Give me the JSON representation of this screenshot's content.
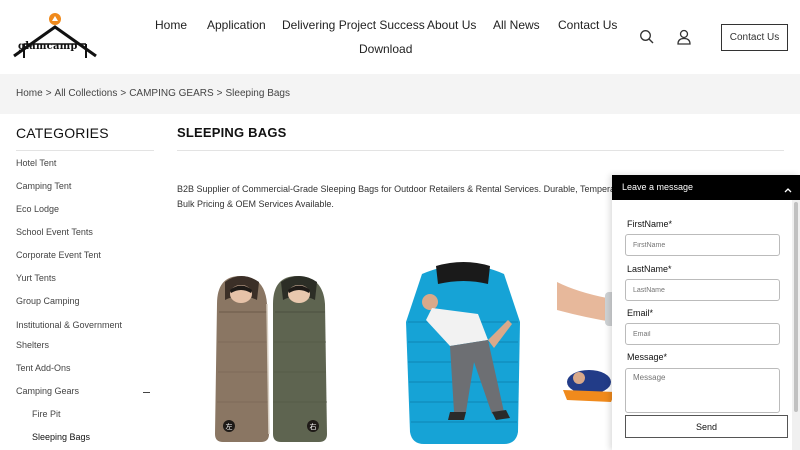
{
  "header": {
    "logo_text": "glamcamp",
    "nav": [
      "Home",
      "Application",
      "Delivering Project Success",
      "About Us",
      "All News",
      "Contact Us",
      "Download"
    ],
    "contact_button": "Contact Us"
  },
  "breadcrumb": [
    "Home",
    "All Collections",
    "CAMPING GEARS",
    "Sleeping Bags"
  ],
  "sidebar": {
    "title": "CATEGORIES",
    "items": [
      "Hotel Tent",
      "Camping Tent",
      "Eco Lodge",
      "School Event Tents",
      "Corporate Event Tent",
      "Yurt Tents",
      "Group Camping",
      "Institutional & Government",
      "Shelters",
      "Tent Add-Ons",
      "Camping Gears",
      "Fire Pit",
      "Sleeping Bags"
    ]
  },
  "main": {
    "title": "SLEEPING BAGS",
    "description_line1": "B2B Supplier of Commercial-Grade Sleeping Bags for Outdoor Retailers & Rental Services. Durable, Temperat",
    "description_line2": "Bulk Pricing & OEM Services Available.",
    "product1_tags": [
      "左",
      "右"
    ]
  },
  "chat": {
    "title": "Leave a message",
    "fields": {
      "first_name_label": "FirstName",
      "first_name_placeholder": "FirstName",
      "last_name_label": "LastName",
      "last_name_placeholder": "LastName",
      "email_label": "Email",
      "email_placeholder": "Email",
      "message_label": "Message",
      "message_placeholder": "Message"
    },
    "required_mark": "*",
    "send": "Send"
  },
  "colors": {
    "accent_orange": "#f08a1c",
    "chat_header": "#000000",
    "band": "#f4f4f4"
  }
}
